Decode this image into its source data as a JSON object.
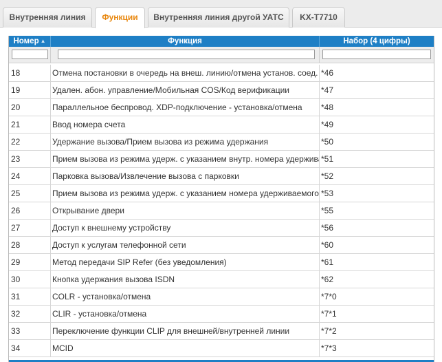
{
  "tabs": [
    {
      "label": "Внутренняя линия",
      "active": false
    },
    {
      "label": "Функции",
      "active": true
    },
    {
      "label": "Внутренняя линия другой УАТС",
      "active": false
    },
    {
      "label": "KX-T7710",
      "active": false
    }
  ],
  "table": {
    "columns": [
      "Номер",
      "Функция",
      "Набор (4 цифры)"
    ],
    "rows": [
      [
        "18",
        "Отмена постановки в очередь на внеш. линию/отмена установ. соед.",
        "*46"
      ],
      [
        "19",
        "Удален. абон. управление/Мобильная COS/Код верификации",
        "*47"
      ],
      [
        "20",
        "Параллельное беспровод. XDP-подключение - установка/отмена",
        "*48"
      ],
      [
        "21",
        "Ввод номера счета",
        "*49"
      ],
      [
        "22",
        "Удержание вызова/Прием вызова из режима удержания",
        "*50"
      ],
      [
        "23",
        "Прием вызова из режима удерж. с указанием внутр. номера удерживаемого",
        "*51"
      ],
      [
        "24",
        "Парковка вызова/Извлечение вызова с парковки",
        "*52"
      ],
      [
        "25",
        "Прием вызова из режима удерж. с указанием номера удерживаемого",
        "*53"
      ],
      [
        "26",
        "Открывание двери",
        "*55"
      ],
      [
        "27",
        "Доступ к внешнему устройству",
        "*56"
      ],
      [
        "28",
        "Доступ к услугам телефонной сети",
        "*60"
      ],
      [
        "29",
        "Метод передачи SIP Refer (без уведомления)",
        "*61"
      ],
      [
        "30",
        "Кнопка удержания вызова ISDN",
        "*62"
      ],
      [
        "31",
        "COLR - установка/отмена",
        "*7*0"
      ],
      [
        "32",
        "CLIR - установка/отмена",
        "*7*1"
      ],
      [
        "33",
        "Переключение функции CLIP для внешней/внутренней линии",
        "*7*2"
      ],
      [
        "34",
        "MCID",
        "*7*3"
      ]
    ]
  },
  "colors": {
    "header": "#1e7fc5",
    "active_tab": "#e8860c"
  }
}
